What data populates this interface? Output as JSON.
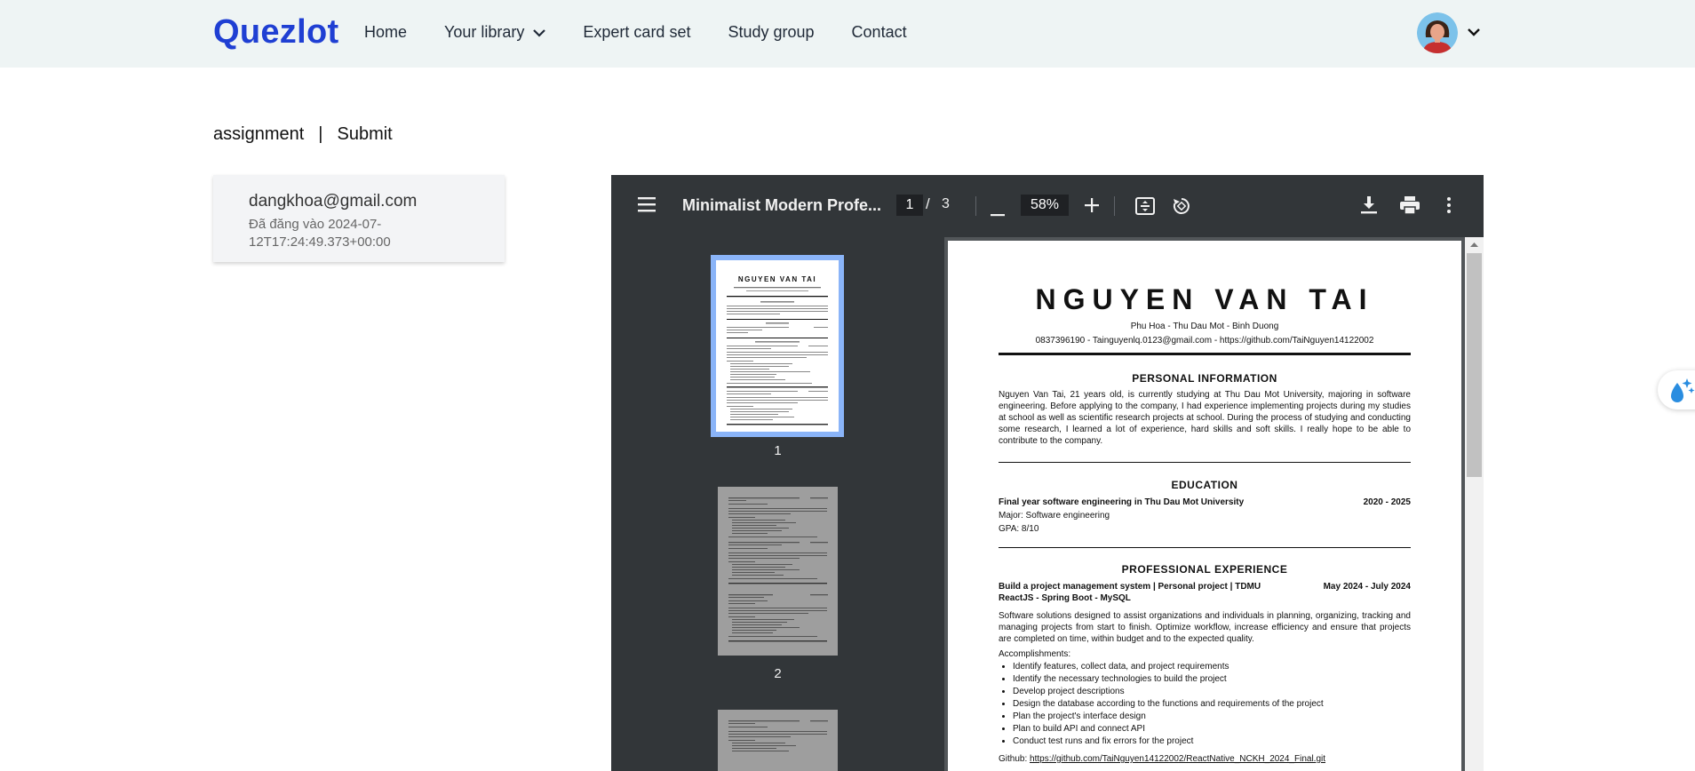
{
  "nav": {
    "brand": "Quezlot",
    "links": [
      "Home",
      "Your library",
      "Expert card set",
      "Study group",
      "Contact"
    ]
  },
  "breadcrumb": {
    "first": "assignment",
    "separator": "|",
    "second": "Submit"
  },
  "submission": {
    "email": "dangkhoa@gmail.com",
    "date": "Đã đăng vào 2024-07-12T17:24:49.373+00:00"
  },
  "viewer": {
    "title": "Minimalist Modern Profe...",
    "current_page": "1",
    "page_separator": "/",
    "total_pages": "3",
    "zoom": "58%",
    "thumb_labels": [
      "1",
      "2"
    ]
  },
  "cv": {
    "name": "NGUYEN VAN TAI",
    "address": "Phu Hoa - Thu Dau Mot - Binh Duong",
    "contact": "0837396190 - Tainguyenlq.0123@gmail.com - https://github.com/TaiNguyen14122002",
    "h_personal": "PERSONAL INFORMATION",
    "personal_text": "Nguyen Van Tai, 21 years old, is currently studying at Thu Dau Mot University, majoring in software engineering. Before applying to the company, I had experience implementing projects during my studies at school as well as scientific research projects at school. During the process of studying and conducting some research, I learned a lot of experience, hard skills and soft skills. I really hope to be able to contribute to the company.",
    "h_education": "EDUCATION",
    "edu_school": "Final year software engineering in Thu Dau Mot University",
    "edu_years": "2020 - 2025",
    "edu_major": "Major: Software engineering",
    "edu_gpa": "GPA: 8/10",
    "h_experience": "PROFESSIONAL EXPERIENCE",
    "exp_title": "Build a project management system | Personal project | TDMU",
    "exp_dates": "May 2024 - July 2024",
    "exp_stack": "ReactJS - Spring Boot - MySQL",
    "exp_desc": "Software solutions designed to assist organizations and individuals in planning, organizing, tracking and managing projects from start to finish. Optimize workflow, increase efficiency and ensure that projects are completed on time, within budget and to the expected quality.",
    "accomplishments_label": "Accomplishments:",
    "accomplishments": [
      "Identify features, collect data, and project requirements",
      "Identify the necessary technologies to build the project",
      "Develop project descriptions",
      "Design the database according to the functions and requirements of the project",
      "Plan the project's interface design",
      "Plan to build API and connect API",
      "Conduct test runs and fix errors for the project"
    ],
    "github_label": "Github:",
    "github_url": "https://github.com/TaiNguyen14122002/ReactNative_NCKH_2024_Final.git"
  },
  "icons": [
    "chevron-down-icon",
    "avatar-icon",
    "menu-icon",
    "zoom-out-icon",
    "zoom-in-icon",
    "fit-page-icon",
    "rotate-icon",
    "download-icon",
    "print-icon",
    "more-vert-icon",
    "sparkle-drop-icon"
  ]
}
